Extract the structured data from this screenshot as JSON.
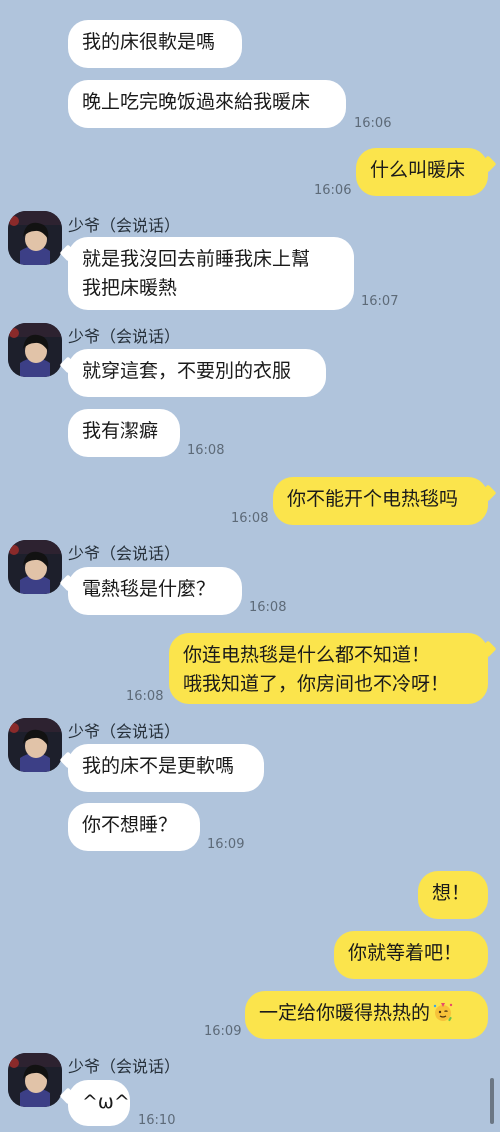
{
  "contact": {
    "name": "少爷（会说话）"
  },
  "messages": [
    {
      "side": "in",
      "text": "我的床很軟是嗎"
    },
    {
      "side": "in",
      "text": "晚上吃完晚饭過來給我暖床",
      "time": "16:06"
    },
    {
      "side": "out",
      "text": "什么叫暖床",
      "time": "16:06"
    },
    {
      "side": "in",
      "text": "就是我沒回去前睡我床上幫",
      "text2": "我把床暖熱",
      "time": "16:07"
    },
    {
      "side": "in",
      "text": "就穿這套，不要別的衣服"
    },
    {
      "side": "in",
      "text": "我有潔癖",
      "time": "16:08"
    },
    {
      "side": "out",
      "text": "你不能开个电热毯吗",
      "time": "16:08"
    },
    {
      "side": "in",
      "text": "電熱毯是什麼？",
      "time": "16:08"
    },
    {
      "side": "out",
      "text": "你连电热毯是什么都不知道！",
      "text2": "哦我知道了，你房间也不冷呀！",
      "time": "16:08"
    },
    {
      "side": "in",
      "text": "我的床不是更軟嗎"
    },
    {
      "side": "in",
      "text": "你不想睡？",
      "time": "16:09"
    },
    {
      "side": "out",
      "text": "想！"
    },
    {
      "side": "out",
      "text": "你就等着吧！"
    },
    {
      "side": "out",
      "text": "一定给你暖得热热的",
      "emoji": "party-face-icon",
      "time": "16:09"
    },
    {
      "side": "in",
      "text": "^ω^",
      "time": "16:10"
    }
  ],
  "colors": {
    "background": "#b0c4dc",
    "incoming_bubble": "#ffffff",
    "outgoing_bubble": "#fbe44c",
    "timestamp": "#5d6a78"
  }
}
